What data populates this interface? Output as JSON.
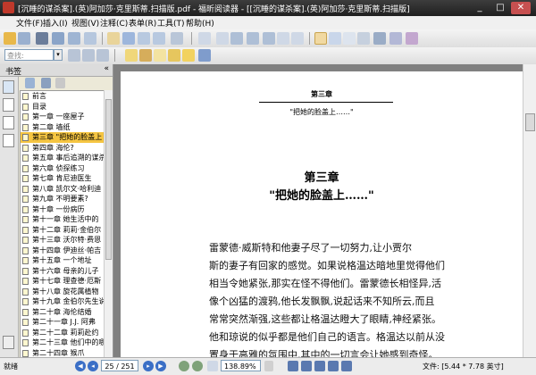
{
  "window": {
    "title": "[沉睡的谋杀案].(英)阿加莎·克里斯蒂.扫描版.pdf - 福昕阅读器 - [[沉睡的谋杀案].(英)阿加莎·克里斯蒂.扫描版]",
    "minimize": "_",
    "maximize": "□",
    "close": "✕"
  },
  "menu": [
    "文件(F)",
    "插入(I)",
    "视图(V)",
    "注释(C)",
    "表单(R)",
    "工具(T)",
    "帮助(H)"
  ],
  "toolbar": {
    "search_placeholder": "查找:"
  },
  "sidebar": {
    "title": "书签",
    "collapse": "«",
    "bookmarks": [
      "前言",
      "目录",
      "第一章 一座屋子",
      "第二章 墙纸",
      "第三章 \"把她的脸盖上",
      "第四章 海伦?",
      "第五章 事后追溯的谋杀",
      "第六章 侦探练习",
      "第七章 肯尼迪医生",
      "第八章 凯尔文·哈利迪",
      "第九章 不明要素?",
      "第十章 一份病历",
      "第十一章 她生活中的",
      "第十二章 莉莉·金伯尔",
      "第十三章 沃尔特·费恩",
      "第十四章 伊迪丝·帕吉",
      "第十五章 一个地址",
      "第十六章 母亲的儿子",
      "第十七章 理查德·厄斯",
      "第十八章 旋花属植物",
      "第十九章 金伯尔先生说",
      "第二十章 海伦结婚",
      "第二十一章 J.J. 阿弗",
      "第二十二章 莉莉赴约",
      "第二十三章 他们中的哪",
      "第二十四章 猴爪"
    ],
    "selected_index": 4
  },
  "page": {
    "running_header": "第三章",
    "running_subheader": "\"把她的脸盖上……\"",
    "chapter_title": "第三章",
    "chapter_subtitle": "\"把她的脸盖上……\"",
    "paragraph_lines": [
      "雷蒙德·威斯特和他妻子尽了一切努力,让小贾尔",
      "斯的妻子有回家的感觉。如果说格温达暗地里觉得他们",
      "相当令她紧张,那实在怪不得他们。雷蒙德长相怪异,活",
      "像个凶猛的渡鸦,他长发飘飘,说起话来不知所云,而且",
      "常常突然渐强,这些都让格温达瞪大了眼睛,神经紧张。",
      "他和琼说的似乎都是他们自己的语言。格温达以前从没",
      "置身于高雅的氛围中,其中的一切言会让她感到奇怪。"
    ]
  },
  "statusbar": {
    "ready": "就绪",
    "page_display": "25 / 251",
    "zoom": "138.89%",
    "doc_size": "文件: [5.44 * 7.78 英寸]"
  }
}
